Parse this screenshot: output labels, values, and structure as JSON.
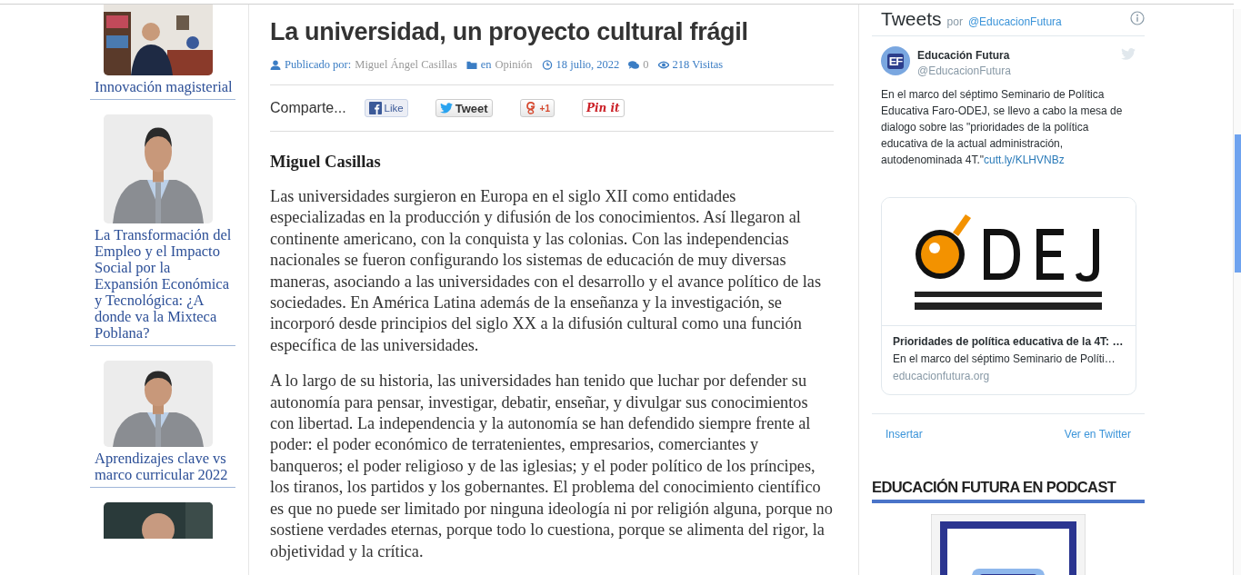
{
  "sidebar": {
    "items": [
      {
        "kind": "office",
        "title": "Innovación magisterial"
      },
      {
        "kind": "portrait",
        "title": "La Transformación del Empleo y el Impacto Social por la Expansión Económica y Tecnológica: ¿A donde va la  Mixteca Poblana?"
      },
      {
        "kind": "portrait",
        "title": "Aprendizajes clave vs marco curricular 2022"
      },
      {
        "kind": "dark"
      }
    ]
  },
  "article": {
    "title": "La universidad, un proyecto cultural frágil",
    "meta": [
      {
        "kind": "author",
        "label": "Publicado por:",
        "value": "Miguel Ángel Casillas"
      },
      {
        "kind": "category",
        "label": "en",
        "value": "Opinión"
      },
      {
        "kind": "date",
        "value": "18 julio, 2022"
      },
      {
        "kind": "comments",
        "value": "0"
      },
      {
        "kind": "views",
        "value": "218 Visitas"
      }
    ],
    "share": {
      "label": "Comparte...",
      "buttons": [
        {
          "kind": "facebook",
          "label": "Like"
        },
        {
          "kind": "twitter",
          "label": "Tweet"
        },
        {
          "kind": "google",
          "label": "+1"
        },
        {
          "kind": "pinterest",
          "label": "Pin it"
        }
      ]
    },
    "author": "Miguel Casillas",
    "paragraphs": [
      "Las universidades surgieron en Europa en el siglo XII como entidades especializadas en la producción y difusión de los conocimientos. Así llegaron al continente americano, con la conquista y las colonias. Con las independencias nacionales se fueron configurando los sistemas de educación de muy diversas maneras, asociando a las universidades con el desarrollo y el avance político de las sociedades. En América Latina además de la enseñanza y la investigación, se incorporó desde principios del siglo XX a la difusión cultural como una función específica de las universidades.",
      "A lo largo de su historia, las universidades han tenido que luchar por defender su autonomía para pensar, investigar, debatir, enseñar, y divulgar sus conocimientos con libertad. La independencia y la autonomía se han defendido siempre frente al poder: el poder económico de terratenientes, empresarios, comerciantes y banqueros; el poder religioso y de las iglesias; y el poder político de los príncipes, los tiranos, los partidos y los gobernantes. El problema del conocimiento científico es que no puede ser limitado por ninguna ideología ni por religión alguna, porque no sostiene verdades eternas, porque todo lo cuestiona, porque se alimenta del rigor, la objetividad y la crítica."
    ]
  },
  "tweets": {
    "title": "Tweets",
    "by": "por",
    "account": "@EducacionFutura",
    "tweet": {
      "avatar": "EF",
      "name": "Educación Futura",
      "handle": "@EducacionFutura",
      "text": "En el marco del séptimo Seminario de Política Educativa Faro-ODEJ, se llevo a cabo la mesa de dialogo sobre las \"prioridades de la política educativa de la actual administración, autodenominada 4T.\"",
      "link": "cutt.ly/KLHVNBz",
      "card": {
        "kind": "picture",
        "title": "Prioridades de política educativa de la 4T: …",
        "description": "En el marco del séptimo Seminario de Políti…",
        "domain": "educacionfutura.org"
      }
    },
    "footer": [
      "Insertar",
      "Ver en Twitter"
    ]
  },
  "podcast": {
    "heading": "EDUCACIÓN FUTURA EN PODCAST",
    "kind": "picture"
  }
}
